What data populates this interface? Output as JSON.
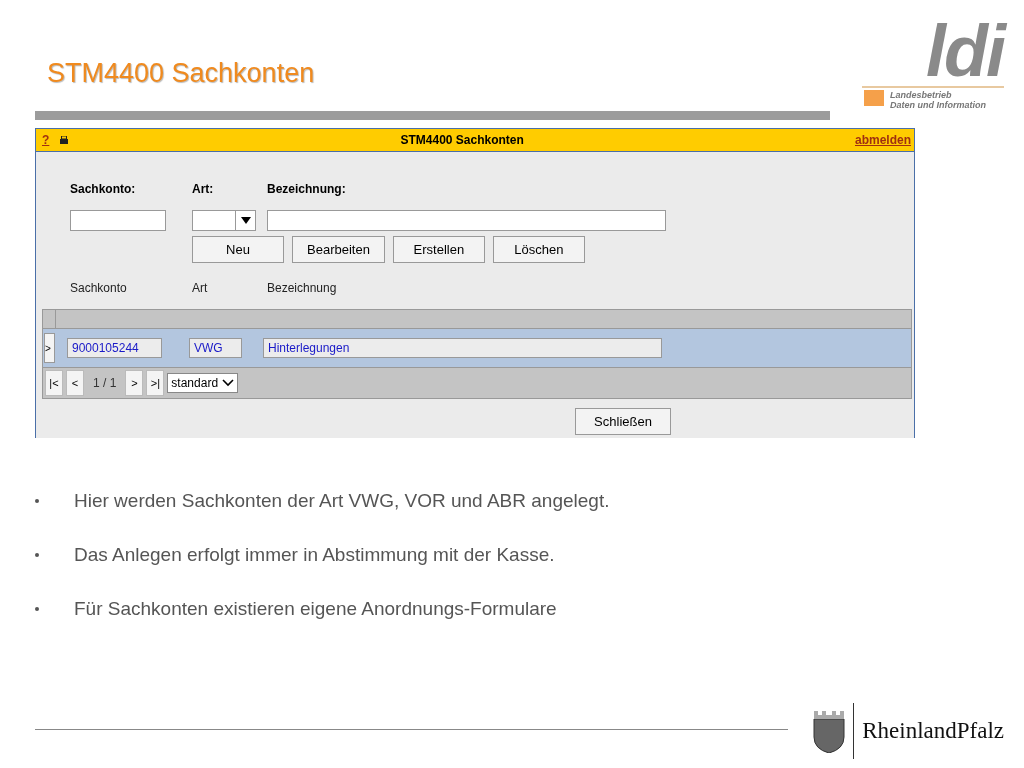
{
  "slide": {
    "title": "STM4400 Sachkonten"
  },
  "logo": {
    "letters": "ldi",
    "line_1": "Landesbetrieb",
    "line_2": "Daten und Information"
  },
  "app": {
    "help": "?",
    "title": "STM4400 Sachkonten",
    "logout": "abmelden",
    "filters": [
      {
        "label": "Sachkonto:",
        "kind": "text"
      },
      {
        "label": "Art:",
        "kind": "select"
      },
      {
        "label": "Bezeichnung:",
        "kind": "wide"
      }
    ],
    "buttons": [
      "Neu",
      "Bearbeiten",
      "Erstellen",
      "Löschen"
    ],
    "columns": [
      "Sachkonto",
      "Art",
      "Bezeichnung"
    ],
    "rows": [
      {
        "marker": ">",
        "cells": [
          "9000105244",
          "VWG",
          "Hinterlegungen"
        ],
        "selected": true
      }
    ],
    "pager": {
      "first": "|<",
      "prev": "<",
      "page": "1 / 1",
      "next": ">",
      "last": ">|",
      "view": "standard"
    },
    "close": "Schließen"
  },
  "bullets": [
    "Hier werden Sachkonten der Art VWG, VOR und ABR angelegt.",
    "Das Anlegen erfolgt immer in Abstimmung mit der Kasse.",
    "Für Sachkonten existieren eigene Anordnungs-Formulare"
  ],
  "footer": {
    "state": "RheinlandPfalz"
  }
}
